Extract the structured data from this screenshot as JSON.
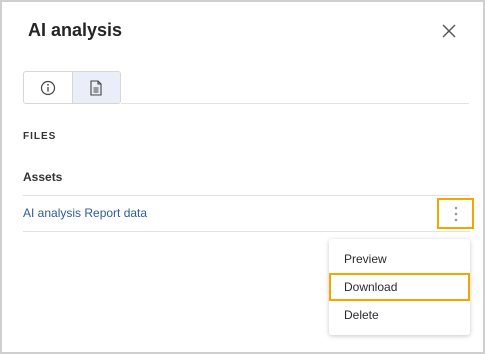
{
  "dialog": {
    "title": "AI analysis",
    "close_icon": "close-icon"
  },
  "tabs": [
    {
      "icon": "info-icon",
      "active": false
    },
    {
      "icon": "document-icon",
      "active": true
    }
  ],
  "files": {
    "section_label": "FILES",
    "group_label": "Assets",
    "items": [
      {
        "name": "AI analysis Report data",
        "menu_icon": "more-vertical-icon"
      }
    ]
  },
  "context_menu": {
    "items": [
      {
        "label": "Preview",
        "highlighted": false
      },
      {
        "label": "Download",
        "highlighted": true
      },
      {
        "label": "Delete",
        "highlighted": false
      }
    ]
  },
  "colors": {
    "accent_highlight": "#f0a800",
    "link": "#2f5a9c",
    "active_tab_bg": "#e9eef9"
  }
}
